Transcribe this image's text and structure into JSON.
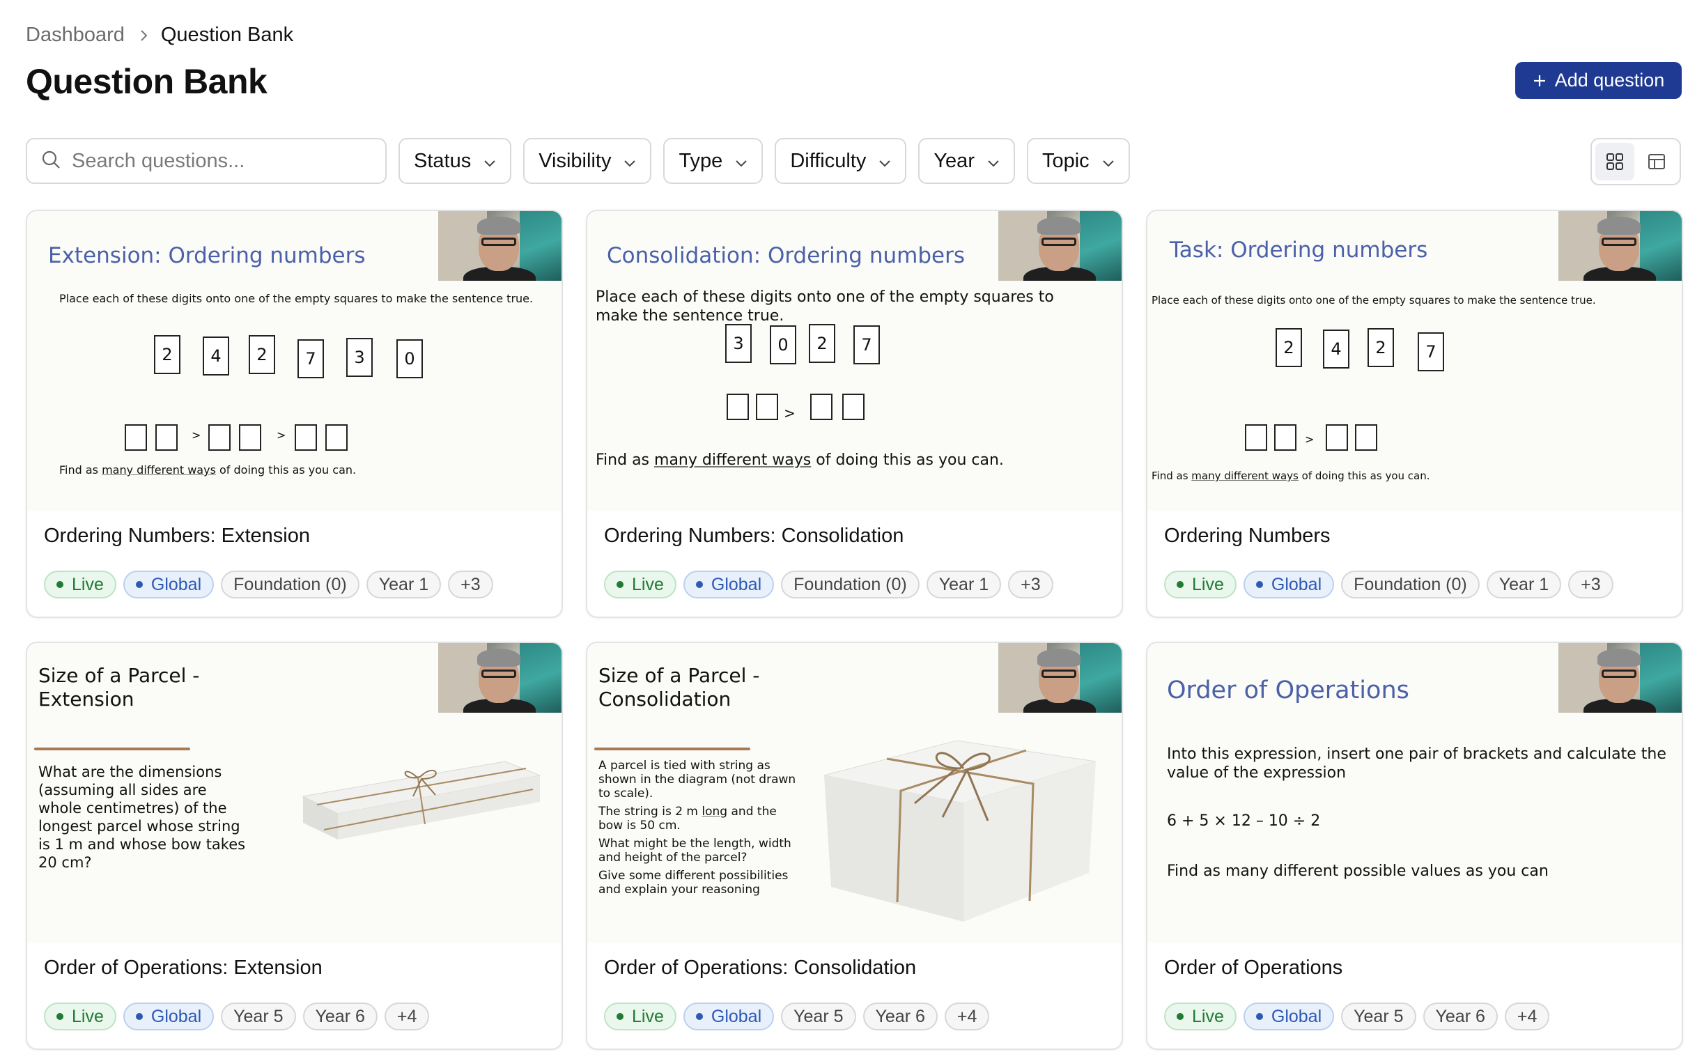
{
  "breadcrumb": {
    "parent": "Dashboard",
    "current": "Question Bank"
  },
  "page_title": "Question Bank",
  "add_button_label": "Add question",
  "search": {
    "placeholder": "Search questions..."
  },
  "filters": [
    "Status",
    "Visibility",
    "Type",
    "Difficulty",
    "Year",
    "Topic"
  ],
  "view_modes": [
    "grid-view-icon",
    "table-view-icon"
  ],
  "colors": {
    "primary": "#1f3a93",
    "live": "#1f7a34",
    "global": "#2d58b4",
    "slide_title": "#4a60a8"
  },
  "cards": [
    {
      "title": "Ordering Numbers: Extension",
      "tags": [
        "Live",
        "Global",
        "Foundation (0)",
        "Year 1",
        "+3"
      ],
      "slide": {
        "heading": "Extension: Ordering numbers",
        "instruction": "Place each of these digits onto one of the empty squares to make the sentence true.",
        "digits": [
          "2",
          "4",
          "2",
          "7",
          "3",
          "0"
        ],
        "footer_pre": "Find as ",
        "footer_link": "many different ways",
        "footer_post": " of doing this as you can."
      }
    },
    {
      "title": "Ordering Numbers: Consolidation",
      "tags": [
        "Live",
        "Global",
        "Foundation (0)",
        "Year 1",
        "+3"
      ],
      "slide": {
        "heading": "Consolidation: Ordering numbers",
        "instruction": "Place each of these digits onto one of the empty squares to make the sentence true.",
        "digits": [
          "3",
          "0",
          "2",
          "7"
        ],
        "footer_pre": "Find as ",
        "footer_link": "many different ways",
        "footer_post": " of doing this as you can."
      }
    },
    {
      "title": "Ordering Numbers",
      "tags": [
        "Live",
        "Global",
        "Foundation (0)",
        "Year 1",
        "+3"
      ],
      "slide": {
        "heading": "Task: Ordering numbers",
        "instruction": "Place each of these digits onto one of the empty squares to make the sentence true.",
        "digits": [
          "2",
          "4",
          "2",
          "7"
        ],
        "footer_pre": "Find as ",
        "footer_link": "many different ways",
        "footer_post": " of doing this as you can."
      }
    },
    {
      "title": "Order of Operations: Extension",
      "tags": [
        "Live",
        "Global",
        "Year 5",
        "Year 6",
        "+4"
      ],
      "slide": {
        "heading_line1": "Size of a Parcel -",
        "heading_line2": "Extension",
        "body": "What are the dimensions (assuming all sides are whole centimetres) of the longest parcel whose string is 1 m and whose bow takes 20 cm?"
      }
    },
    {
      "title": "Order of Operations: Consolidation",
      "tags": [
        "Live",
        "Global",
        "Year 5",
        "Year 6",
        "+4"
      ],
      "slide": {
        "heading_line1": "Size of a Parcel -",
        "heading_line2": "Consolidation",
        "p1": "A parcel is tied with string as shown in the diagram (not drawn to scale).",
        "p2_pre": "The string is 2 m ",
        "p2_link": "long",
        "p2_post": " and the bow is 50 cm.",
        "p3": "What might be the length, width and height of the parcel?",
        "p4": "Give some different possibilities and explain your reasoning"
      }
    },
    {
      "title": "Order of Operations",
      "tags": [
        "Live",
        "Global",
        "Year 5",
        "Year 6",
        "+4"
      ],
      "slide": {
        "heading": "Order of Operations",
        "p1": "Into this expression, insert one pair of brackets and calculate the value of the expression",
        "expression": "6 + 5 × 12 – 10 ÷ 2",
        "p2": "Find as many different possible values as you can"
      }
    }
  ]
}
